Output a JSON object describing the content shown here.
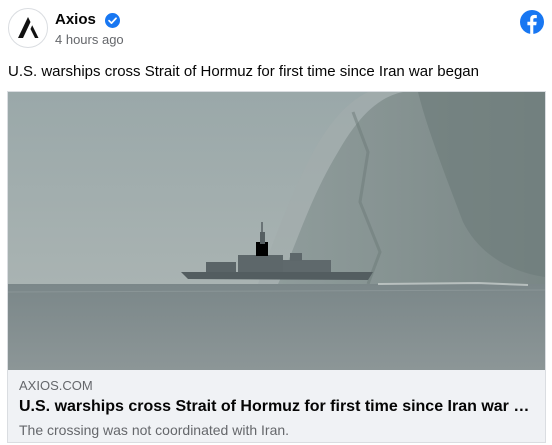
{
  "post": {
    "author": "Axios",
    "timestamp": "4 hours ago",
    "text": "U.S. warships cross Strait of Hormuz for first time since Iran war began"
  },
  "link_card": {
    "domain": "AXIOS.COM",
    "title": "U.S. warships cross Strait of Hormuz for first time since Iran war began",
    "description": "The crossing was not coordinated with Iran."
  },
  "icons": {
    "avatar": "axios-logo-icon",
    "verified": "verified-badge-icon",
    "platform": "facebook-icon"
  },
  "colors": {
    "verified_blue": "#1877f2",
    "facebook_blue": "#1877f2",
    "card_bg": "#f0f2f5",
    "secondary_text": "#65676b"
  }
}
